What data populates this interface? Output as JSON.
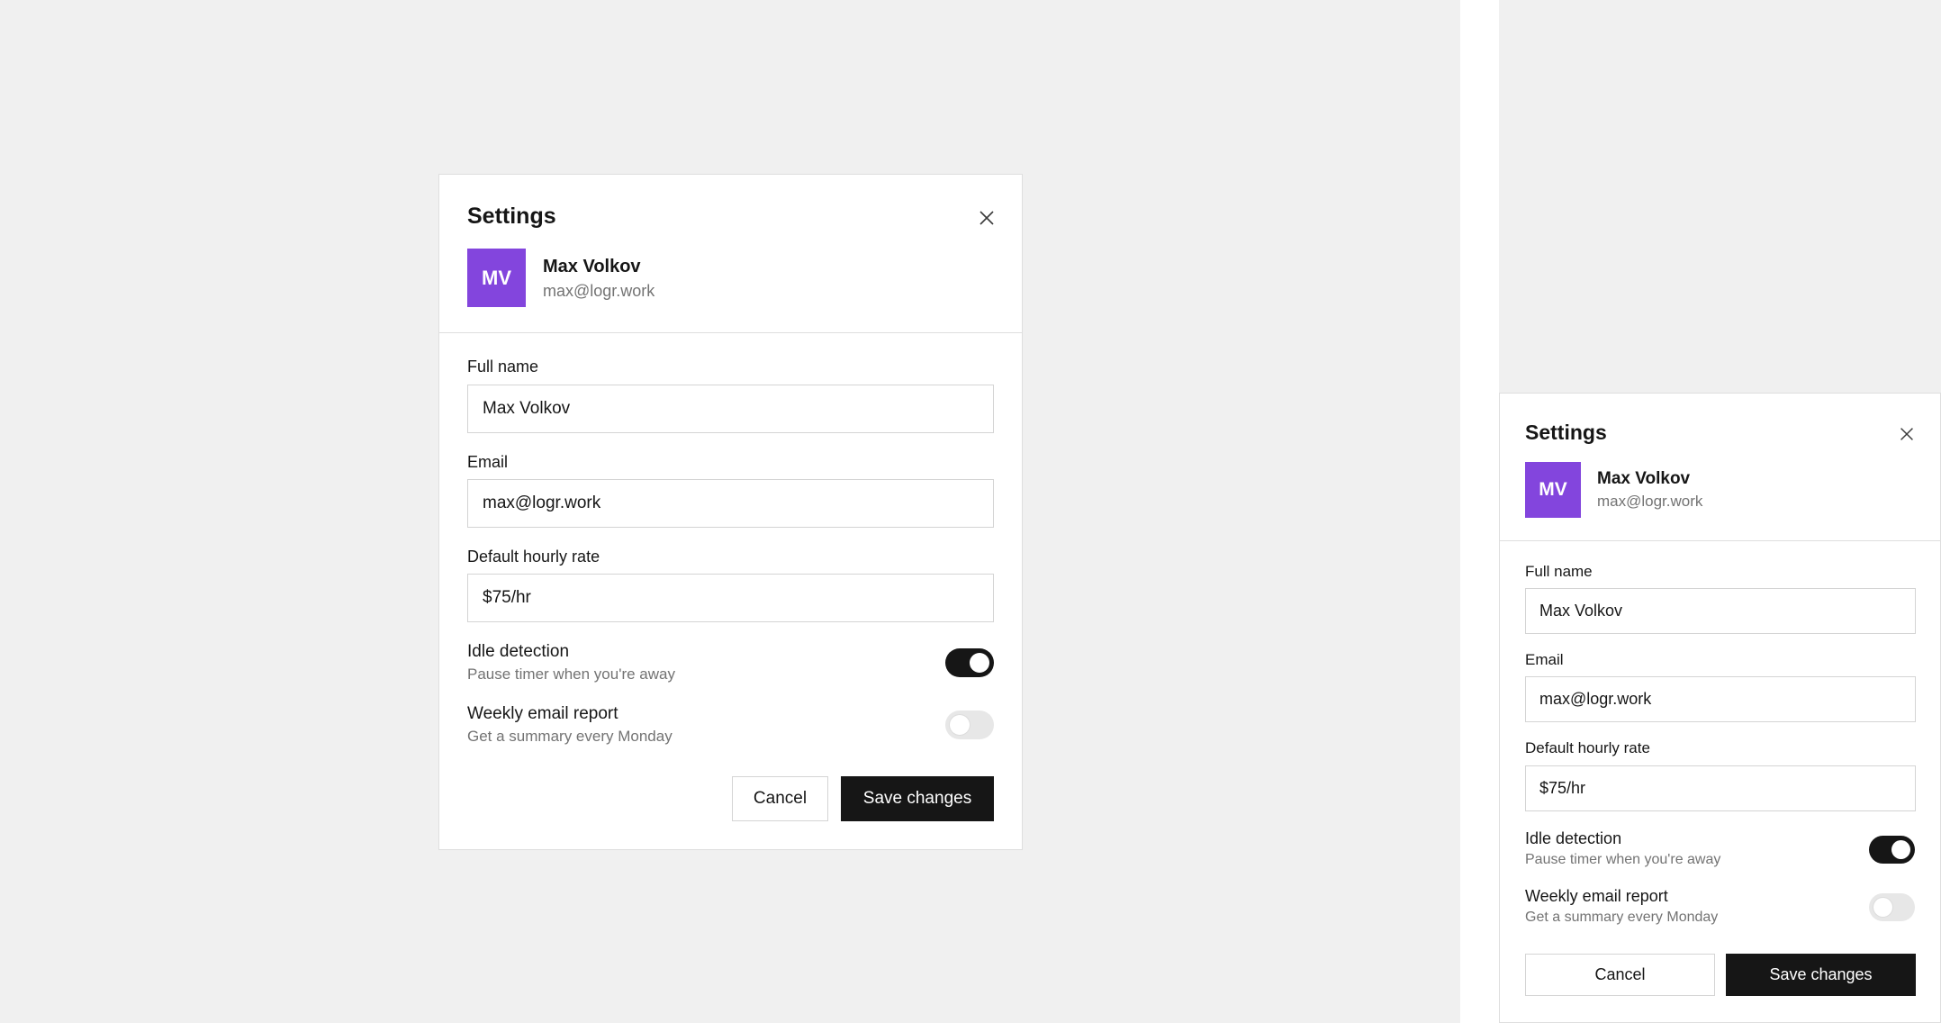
{
  "dialog": {
    "title": "Settings",
    "close_icon": "close-icon",
    "user": {
      "initials": "MV",
      "name": "Max Volkov",
      "email": "max@logr.work",
      "avatar_color": "#8345dd"
    },
    "fields": {
      "full_name": {
        "label": "Full name",
        "value": "Max Volkov"
      },
      "email": {
        "label": "Email",
        "value": "max@logr.work"
      },
      "hourly_rate": {
        "label": "Default hourly rate",
        "value": "$75/hr"
      }
    },
    "toggles": {
      "idle_detection": {
        "label": "Idle detection",
        "description": "Pause timer when you're away",
        "on": true
      },
      "weekly_report": {
        "label": "Weekly email report",
        "description": "Get a summary every Monday",
        "on": false
      }
    },
    "buttons": {
      "cancel": "Cancel",
      "save": "Save changes"
    }
  }
}
